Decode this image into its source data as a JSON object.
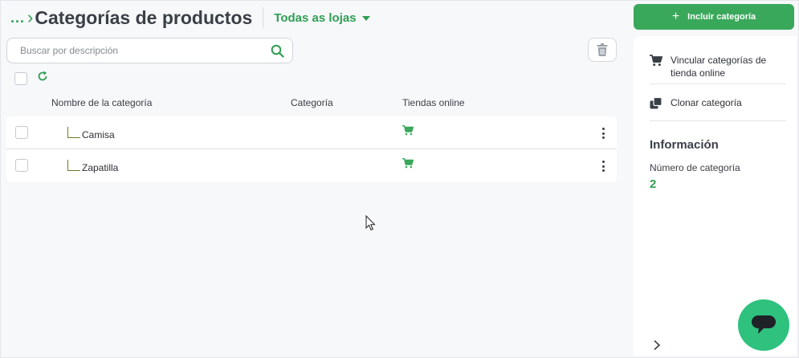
{
  "header": {
    "breadcrumb_ellipsis": "...",
    "title": "Categorías de productos",
    "store_selector": "Todas as lojas"
  },
  "search": {
    "placeholder": "Buscar por descripción",
    "value": ""
  },
  "table": {
    "columns": [
      "Nombre de la categoría",
      "Categoría",
      "Tiendas online"
    ],
    "rows": [
      {
        "name": "Camisa",
        "category": "",
        "online_store_icon": "cart-icon"
      },
      {
        "name": "Zapatilla",
        "category": "",
        "online_store_icon": "cart-icon"
      }
    ]
  },
  "sidebar": {
    "add_button_label": "Incluir categoría",
    "actions": [
      {
        "label": "Vincular categorías de tienda online",
        "icon": "cart-icon"
      },
      {
        "label": "Clonar categoría",
        "icon": "clone-icon"
      }
    ],
    "info": {
      "title": "Información",
      "label": "Número de categoría",
      "value": "2"
    }
  },
  "colors": {
    "accent": "#2f9e54",
    "button": "#3aa85b",
    "chat": "#2ec27e"
  }
}
